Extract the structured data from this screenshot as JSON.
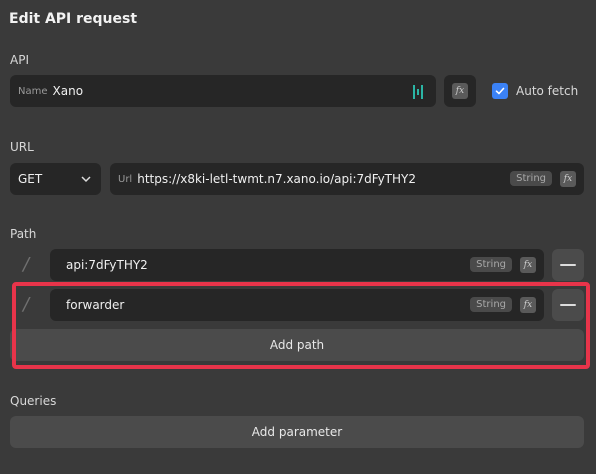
{
  "title": "Edit API request",
  "api": {
    "section_label": "API",
    "name_label": "Name",
    "name_value": "Xano",
    "auto_fetch_label": "Auto fetch",
    "auto_fetch_checked": true
  },
  "url": {
    "section_label": "URL",
    "method": "GET",
    "url_label": "Url",
    "url_value": "https://x8ki-letl-twmt.n7.xano.io/api:7dFyTHY2",
    "type_badge": "String"
  },
  "path": {
    "section_label": "Path",
    "segments": [
      {
        "separator": "/",
        "value": "api:7dFyTHY2",
        "type_badge": "String"
      },
      {
        "separator": "/",
        "value": "forwarder",
        "type_badge": "String"
      }
    ],
    "add_path_label": "Add path"
  },
  "queries": {
    "section_label": "Queries",
    "add_parameter_label": "Add parameter"
  },
  "fx_label": "fx",
  "colors": {
    "background": "#3a3a3a",
    "field": "#262626",
    "button": "#4b4b4b",
    "accent": "#3b82f6",
    "highlight": "#e8344a",
    "xano_icon": "#2bb5a5"
  }
}
